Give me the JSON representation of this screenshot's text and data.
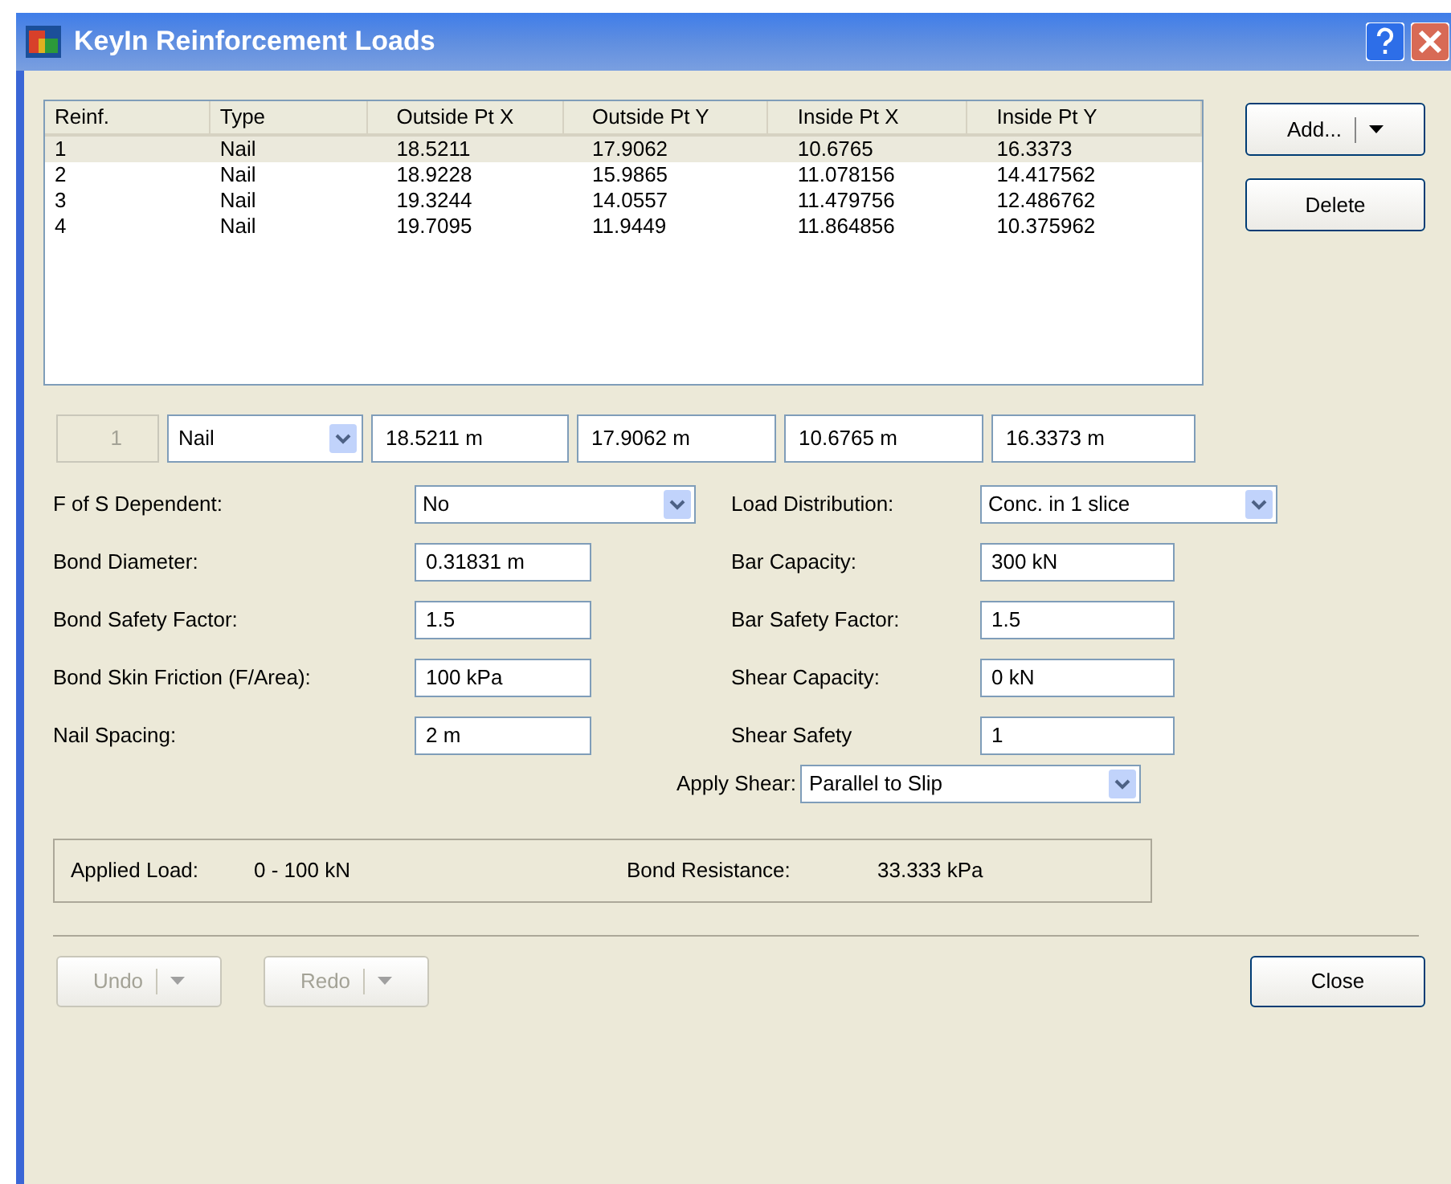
{
  "window": {
    "title": "KeyIn Reinforcement Loads"
  },
  "table": {
    "columns": [
      "Reinf.",
      "Type",
      "Outside Pt X",
      "Outside Pt Y",
      "Inside Pt X",
      "Inside Pt Y"
    ],
    "rows": [
      {
        "cells": [
          "1",
          "Nail",
          "18.5211",
          "17.9062",
          "10.6765",
          "16.3373"
        ],
        "selected": true
      },
      {
        "cells": [
          "2",
          "Nail",
          "18.9228",
          "15.9865",
          "11.078156",
          "14.417562"
        ],
        "selected": false
      },
      {
        "cells": [
          "3",
          "Nail",
          "19.3244",
          "14.0557",
          "11.479756",
          "12.486762"
        ],
        "selected": false
      },
      {
        "cells": [
          "4",
          "Nail",
          "19.7095",
          "11.9449",
          "11.864856",
          "10.375962"
        ],
        "selected": false
      }
    ]
  },
  "side_buttons": [
    {
      "label": "Add...",
      "kind": "split"
    },
    {
      "label": "Delete",
      "kind": "plain"
    }
  ],
  "editor": {
    "index": {
      "value": "1",
      "disabled": true
    },
    "type": {
      "value": "Nail"
    },
    "fields": [
      "18.5211 m",
      "17.9062 m",
      "10.6765 m",
      "16.3373 m"
    ]
  },
  "form": {
    "left": [
      {
        "kind": "combo",
        "label": "F of S Dependent:",
        "value": "No"
      },
      {
        "kind": "field",
        "label": "Bond Diameter:",
        "value": "0.31831 m"
      },
      {
        "kind": "field",
        "label": "Bond Safety Factor:",
        "value": "1.5"
      },
      {
        "kind": "field",
        "label": "Bond Skin Friction (F/Area):",
        "value": "100 kPa"
      },
      {
        "kind": "field",
        "label": "Nail Spacing:",
        "value": "2 m"
      }
    ],
    "right": [
      {
        "kind": "combo",
        "label": "Load Distribution:",
        "value": "Conc. in 1 slice"
      },
      {
        "kind": "field",
        "label": "Bar Capacity:",
        "value": "300 kN"
      },
      {
        "kind": "field",
        "label": "Bar Safety Factor:",
        "value": "1.5"
      },
      {
        "kind": "field",
        "label": "Shear Capacity:",
        "value": "0 kN"
      },
      {
        "kind": "field",
        "label": "Shear Safety",
        "value": "1"
      }
    ],
    "apply_shear": {
      "label": "Apply Shear:",
      "value": "Parallel to Slip"
    }
  },
  "summary": [
    {
      "label": "Applied Load:",
      "value": "0 - 100 kN"
    },
    {
      "label": "Bond Resistance:",
      "value": "33.333 kPa"
    }
  ],
  "footer": [
    {
      "label": "Undo",
      "disabled": true,
      "kind": "split"
    },
    {
      "label": "Redo",
      "disabled": true,
      "kind": "split"
    },
    {
      "label": "Close",
      "disabled": false,
      "kind": "plain"
    }
  ]
}
